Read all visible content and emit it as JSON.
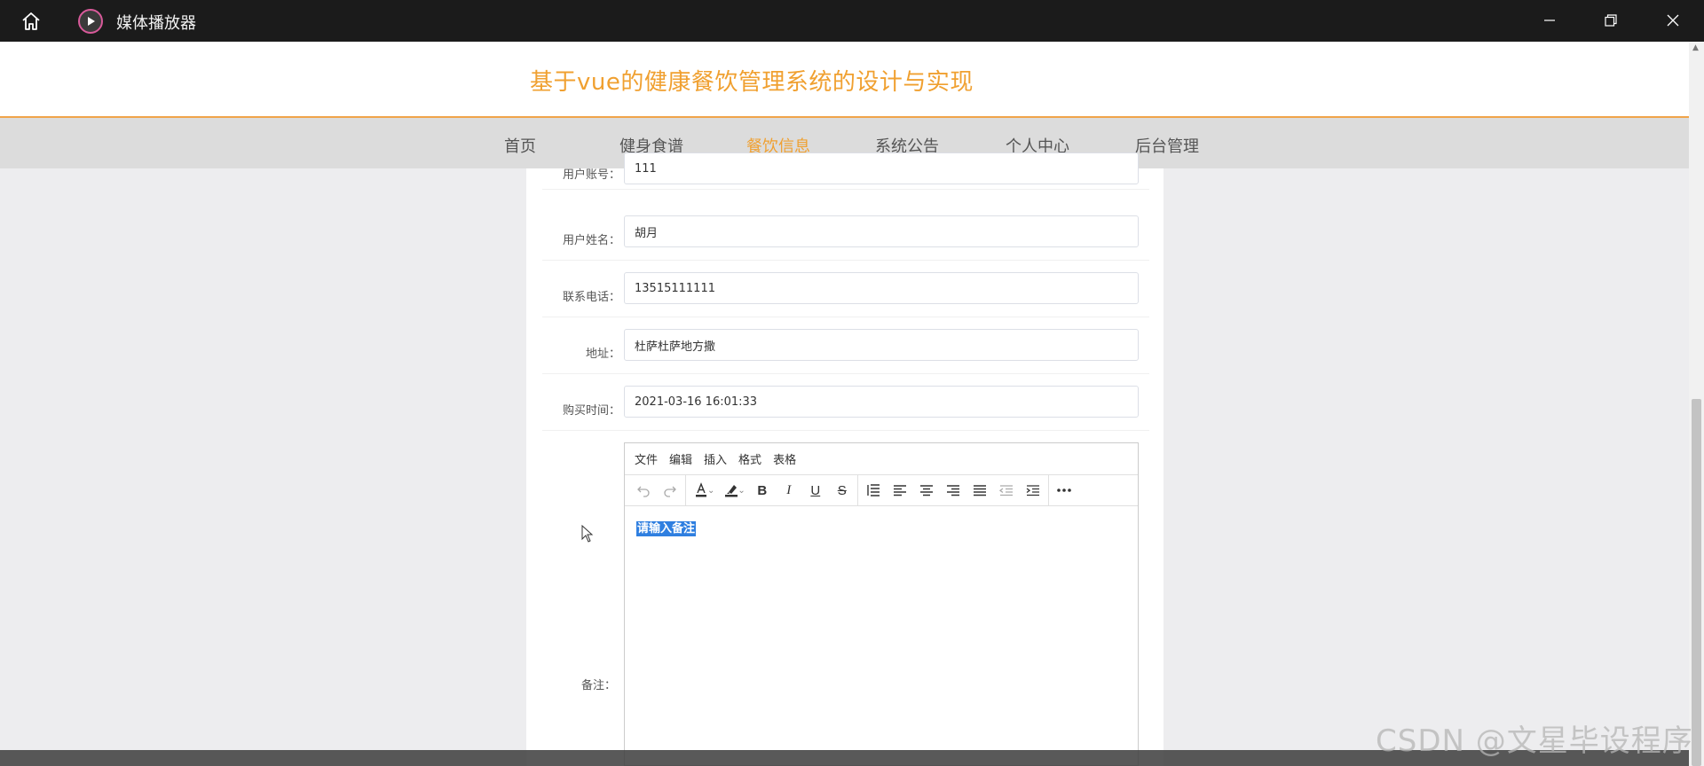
{
  "window": {
    "app_title": "媒体播放器",
    "home_icon": "home-icon",
    "logo_icon": "play-icon",
    "controls": [
      "minimize-icon",
      "restore-icon",
      "close-icon"
    ]
  },
  "site": {
    "title": "基于vue的健康餐饮管理系统的设计与实现",
    "accent_color": "#f0a030"
  },
  "nav": {
    "items": [
      {
        "label": "首页",
        "active": false
      },
      {
        "label": "健身食谱",
        "active": false
      },
      {
        "label": "餐饮信息",
        "active": true
      },
      {
        "label": "系统公告",
        "active": false
      },
      {
        "label": "个人中心",
        "active": false
      },
      {
        "label": "后台管理",
        "active": false
      }
    ]
  },
  "form": {
    "fields": [
      {
        "label": "用户账号：",
        "value": "111"
      },
      {
        "label": "用户姓名：",
        "value": "胡月"
      },
      {
        "label": "联系电话：",
        "value": "13515111111"
      },
      {
        "label": "地址：",
        "value": "杜萨杜萨地方撒"
      },
      {
        "label": "购买时间：",
        "value": "2021-03-16 16:01:33"
      }
    ],
    "remark": {
      "label": "备注：",
      "editor_menu": [
        "文件",
        "编辑",
        "插入",
        "格式",
        "表格"
      ],
      "placeholder_text": "请输入备注"
    }
  },
  "watermark": "CSDN @文星毕设程序"
}
